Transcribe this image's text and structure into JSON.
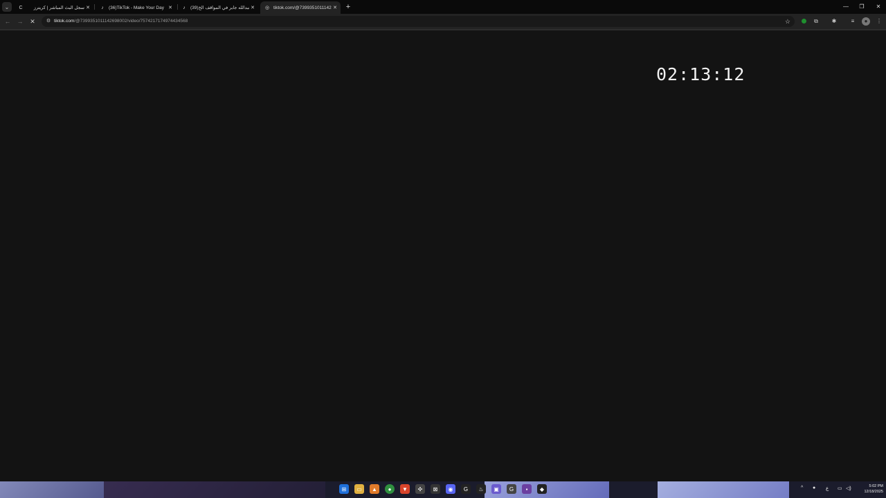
{
  "browser": {
    "tabs": [
      {
        "title": "سجل البث المباشر | كريترز",
        "icon": "C",
        "active": false
      },
      {
        "title": "(36)TikTok - Make Your Day",
        "icon": "♪",
        "active": false
      },
      {
        "title": "(39)عبدالله جابر في المواقف الخ...",
        "icon": "♪",
        "active": false
      },
      {
        "title": "tiktok.com/@73993510111426...",
        "icon": "◎",
        "active": true
      }
    ],
    "url_host": "tiktok.com",
    "url_path": "/@7399351011142698002/video/7574217174974434568"
  },
  "page": {
    "timer": "02:13:12"
  },
  "taskbar": {
    "time": "5:02 PM",
    "date": "12/18/2025",
    "tray_lang": "ع"
  }
}
